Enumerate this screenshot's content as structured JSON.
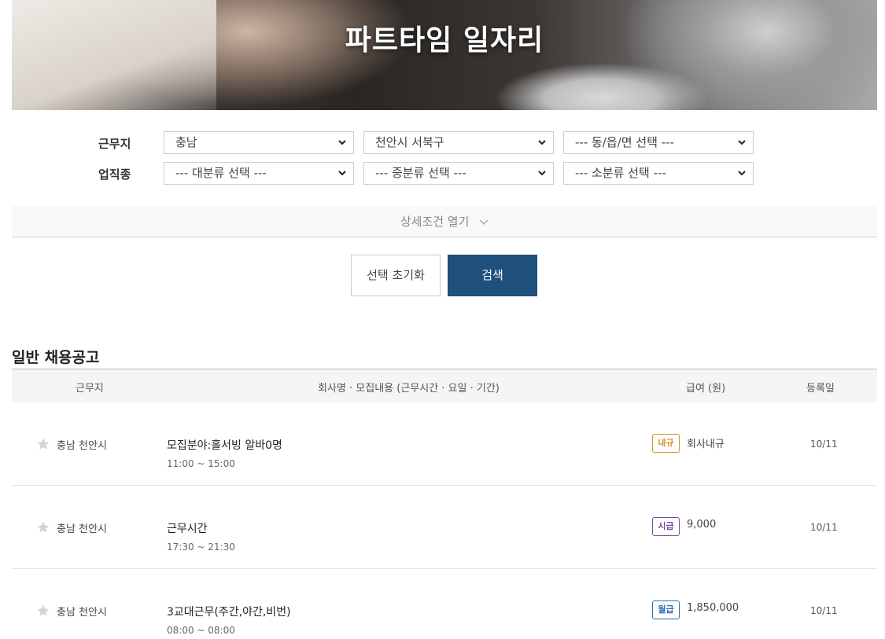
{
  "hero": {
    "title": "파트타임 일자리"
  },
  "filters": {
    "location_label": "근무지",
    "job_label": "업직종",
    "province": "충남",
    "city": "천안시 서북구",
    "town": "--- 동/읍/면 선택 ---",
    "category_major": "--- 대분류 선택 ---",
    "category_mid": "--- 중분류 선택 ---",
    "category_minor": "--- 소분류 선택 ---"
  },
  "detail_toggle": {
    "label": "상세조건 열기"
  },
  "actions": {
    "reset_label": "선택 초기화",
    "search_label": "검색"
  },
  "listing": {
    "section_title": "일반 채용공고",
    "columns": {
      "location": "근무지",
      "content": "회사명 · 모집내용 (근무시간 · 요일 · 기간)",
      "pay": "급여 (원)",
      "date": "등록일"
    },
    "rows": [
      {
        "location": "충남 천안시",
        "title": "모집분야:홀서빙 알바0명",
        "time": "11:00 ~ 15:00",
        "pay_type": "내규",
        "pay_type_color": "#d4912c",
        "pay": "회사내규",
        "date": "10/11"
      },
      {
        "location": "충남 천안시",
        "title": "근무시간",
        "time": "17:30 ~ 21:30",
        "pay_type": "시급",
        "pay_type_color": "#7a4a9c",
        "pay": "9,000",
        "date": "10/11"
      },
      {
        "location": "충남 천안시",
        "title": "3교대근무(주간,야간,비번)",
        "time": "08:00 ~ 08:00",
        "pay_type": "월급",
        "pay_type_color": "#2a6fb0",
        "pay": "1,850,000",
        "date": "10/11"
      }
    ]
  },
  "icons": {
    "star": "star-icon",
    "chevron": "chevron-down-icon"
  },
  "colors": {
    "primary": "#1f4f7d"
  }
}
